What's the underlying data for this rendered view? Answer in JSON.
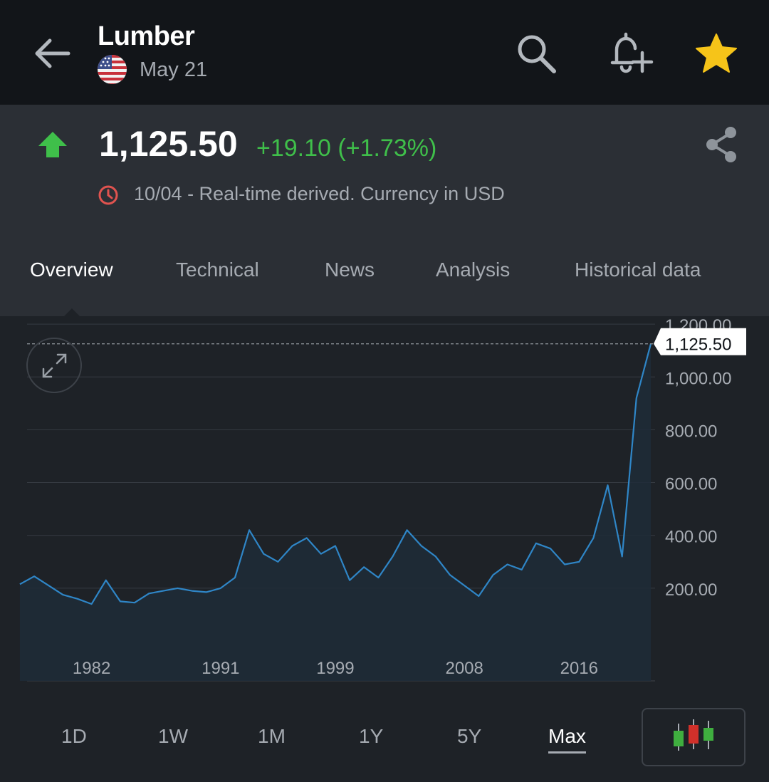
{
  "header": {
    "title": "Lumber",
    "subtitle": "May 21",
    "flag_icon": "us-flag-icon"
  },
  "quote": {
    "price": "1,125.50",
    "change": "+19.10 (+1.73%)",
    "status": "10/04 - Real-time derived. Currency in USD",
    "up_color": "#3fbf4a",
    "clock_color": "#e0534f"
  },
  "tabs": [
    {
      "label": "Overview",
      "active": true
    },
    {
      "label": "Technical",
      "active": false
    },
    {
      "label": "News",
      "active": false
    },
    {
      "label": "Analysis",
      "active": false
    },
    {
      "label": "Historical data",
      "active": false
    }
  ],
  "chart_data": {
    "type": "area",
    "x": [
      1977,
      1978,
      1979,
      1980,
      1981,
      1982,
      1983,
      1984,
      1985,
      1986,
      1987,
      1988,
      1989,
      1990,
      1991,
      1992,
      1993,
      1994,
      1995,
      1996,
      1997,
      1998,
      1999,
      2000,
      2001,
      2002,
      2003,
      2004,
      2005,
      2006,
      2007,
      2008,
      2009,
      2010,
      2011,
      2012,
      2013,
      2014,
      2015,
      2016,
      2017,
      2018,
      2019,
      2020,
      2021
    ],
    "values": [
      215,
      245,
      210,
      175,
      160,
      140,
      230,
      150,
      145,
      180,
      190,
      200,
      190,
      185,
      200,
      240,
      420,
      330,
      300,
      360,
      390,
      330,
      360,
      230,
      280,
      240,
      320,
      420,
      360,
      320,
      250,
      210,
      170,
      250,
      290,
      270,
      370,
      350,
      290,
      300,
      390,
      590,
      320,
      920,
      1125.5
    ],
    "x_tick_labels": [
      "1982",
      "1991",
      "1999",
      "2008",
      "2016"
    ],
    "x_ticks": [
      1982,
      1991,
      1999,
      2008,
      2016
    ],
    "y_tick_labels": [
      "1,200.00",
      "1,000.00",
      "800.00",
      "600.00",
      "400.00",
      "200.00"
    ],
    "y_ticks": [
      1200,
      1000,
      800,
      600,
      400,
      200
    ],
    "ylim": [
      0,
      1230
    ],
    "xlim": [
      1977.5,
      2021.3
    ],
    "last_value_label": "1,125.50",
    "last_value": 1125.5,
    "line_color": "#2f86c7",
    "grid": true
  },
  "ranges": [
    {
      "label": "1D",
      "active": false
    },
    {
      "label": "1W",
      "active": false
    },
    {
      "label": "1M",
      "active": false
    },
    {
      "label": "1Y",
      "active": false
    },
    {
      "label": "5Y",
      "active": false
    },
    {
      "label": "Max",
      "active": true
    }
  ]
}
